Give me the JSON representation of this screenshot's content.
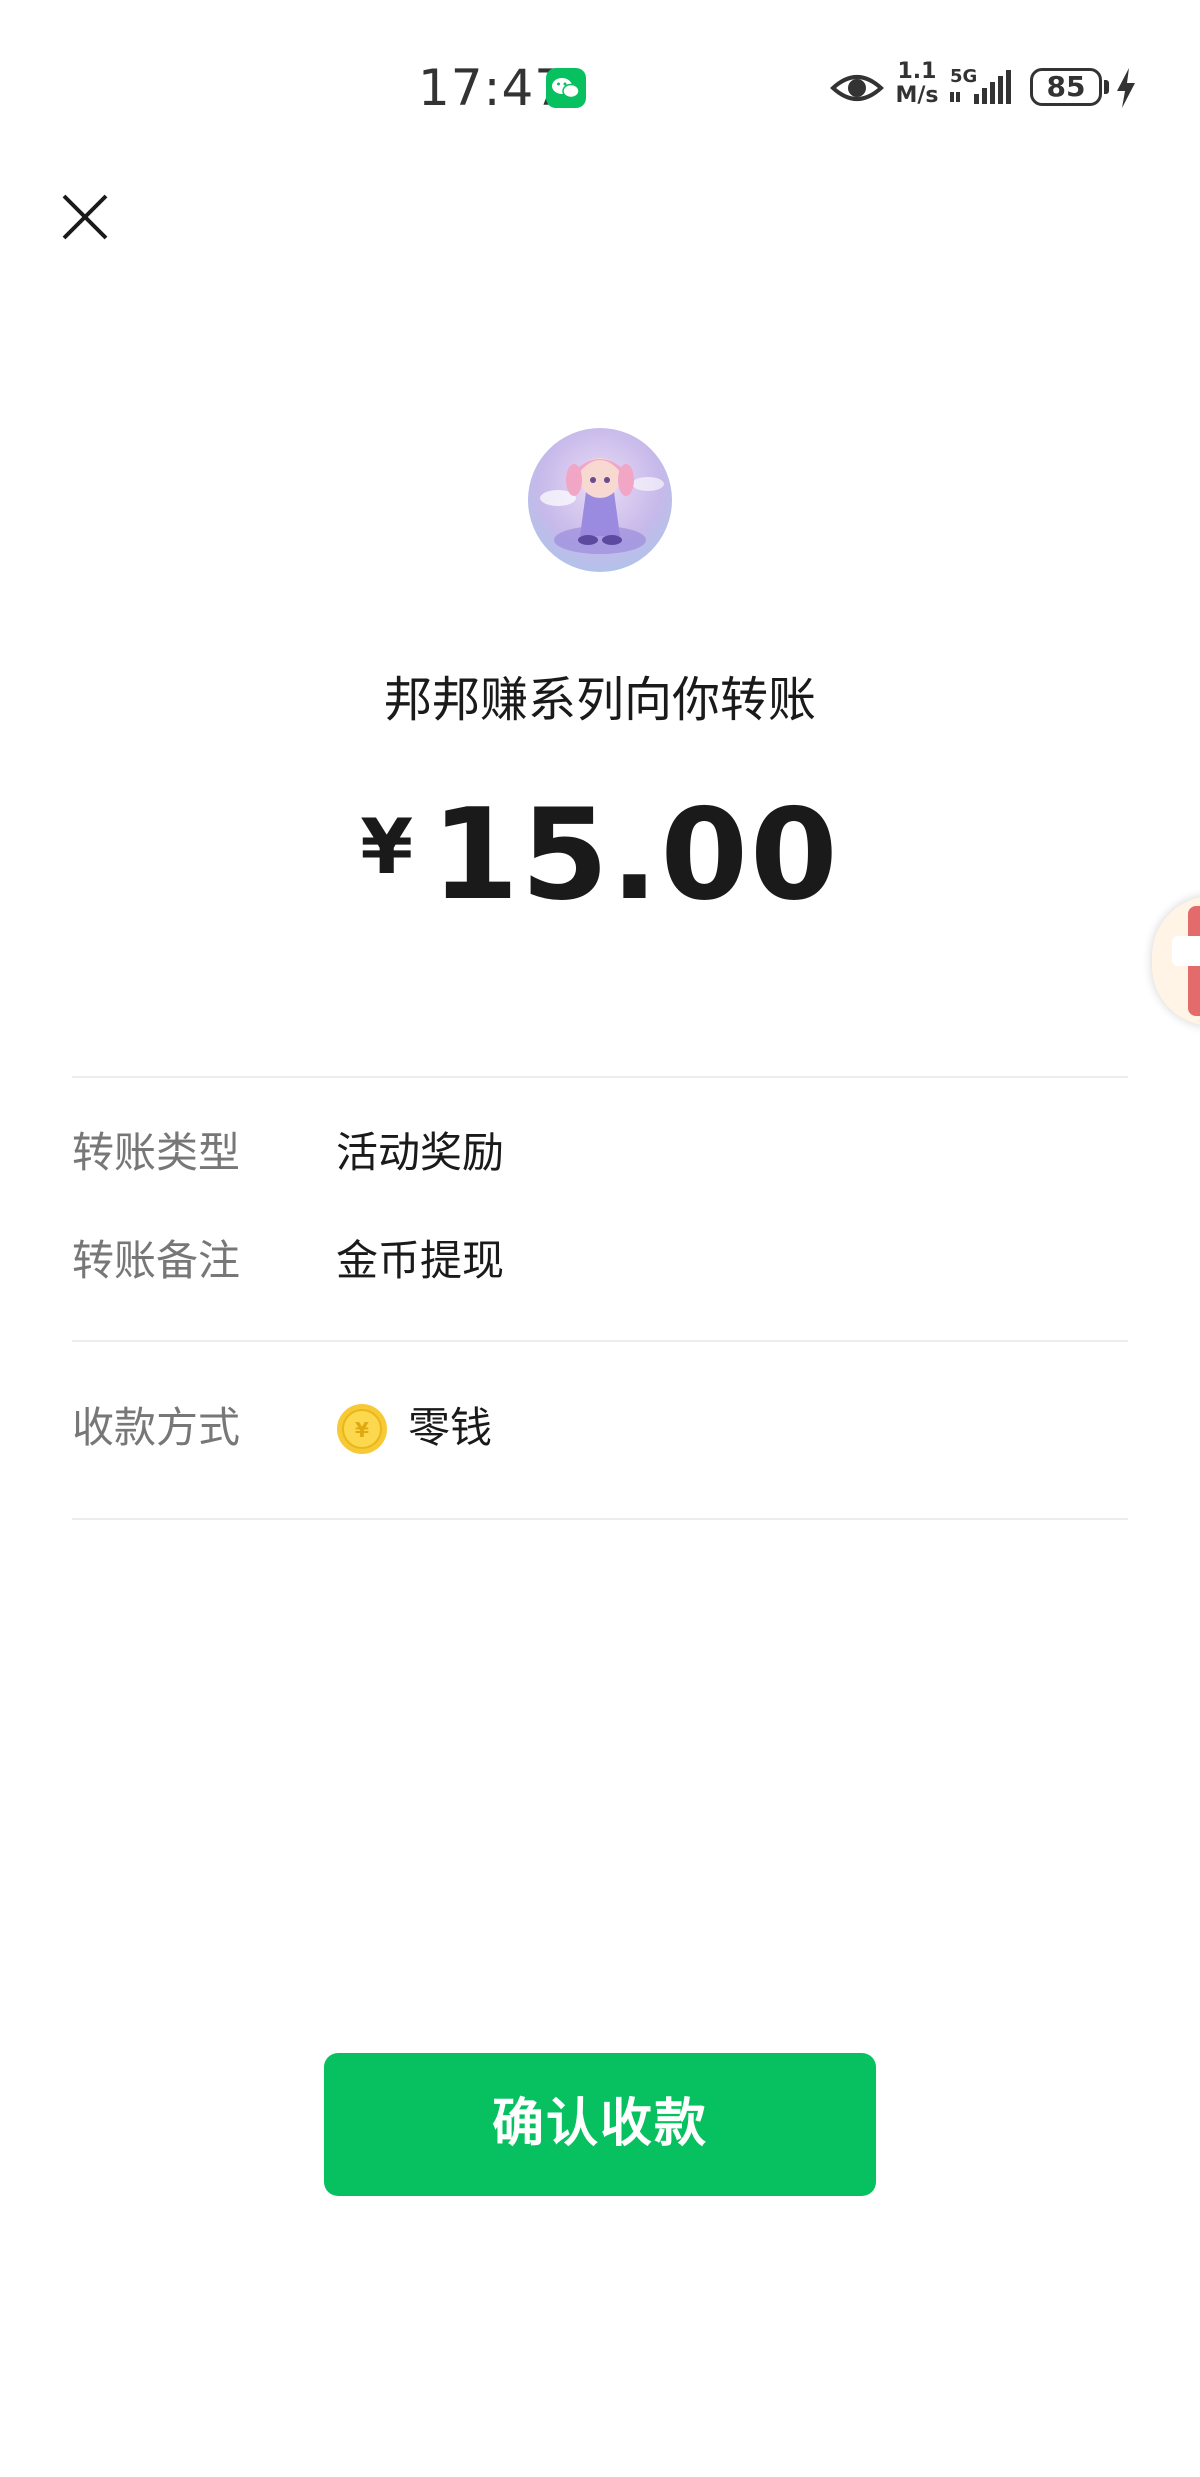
{
  "status_bar": {
    "time": "17:47",
    "net_speed_value": "1.1",
    "net_speed_unit": "M/s",
    "network": "5G",
    "battery": "85"
  },
  "transfer": {
    "title": "邦邦赚系列向你转账",
    "currency_symbol": "¥",
    "amount": "15.00"
  },
  "details": {
    "type_label": "转账类型",
    "type_value": "活动奖励",
    "note_label": "转账备注",
    "note_value": "金币提现",
    "method_label": "收款方式",
    "method_value": "零钱"
  },
  "actions": {
    "confirm_label": "确认收款"
  },
  "colors": {
    "accent": "#07c160",
    "coin": "#f7c936"
  }
}
